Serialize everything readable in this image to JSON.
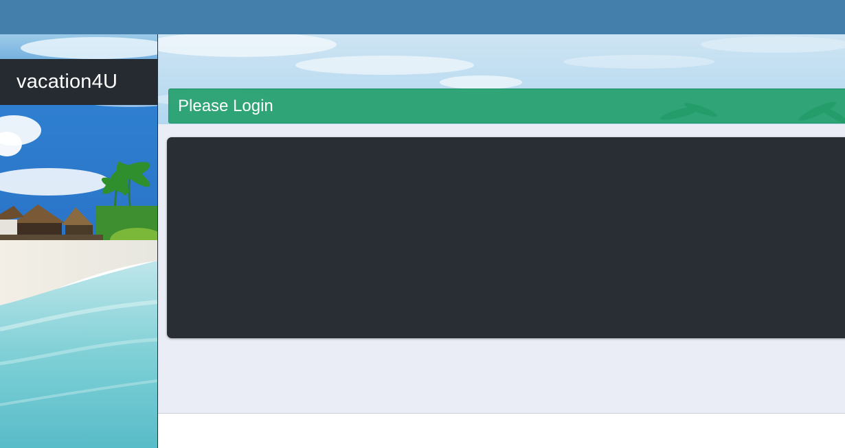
{
  "app": {
    "brand_title": "vacation4U"
  },
  "login": {
    "header_title": "Please Login"
  },
  "images": {
    "sidebar_background": "tropical-beach-photo",
    "hero_background": "sky-palm-banner-photo"
  },
  "colors": {
    "top_bar": "#447eab",
    "brand_bg": "#262b31",
    "login_header": "#24a06c",
    "login_panel": "#292e34",
    "content_bg": "#eaedf5"
  }
}
